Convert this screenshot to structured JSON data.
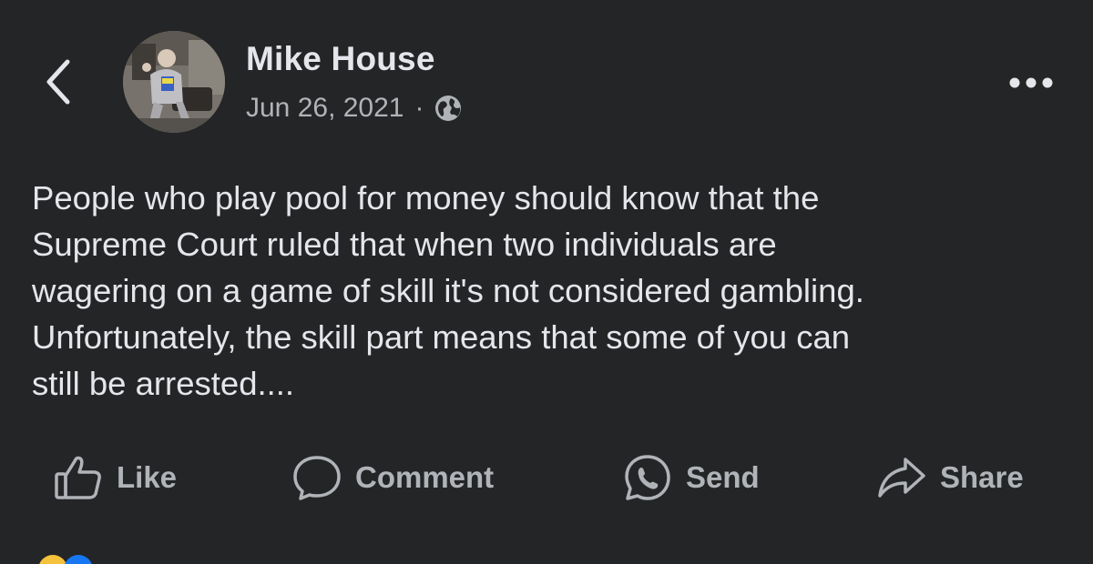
{
  "post": {
    "author": "Mike House",
    "date": "Jun 26, 2021",
    "separator": "·",
    "privacy_icon": "globe-icon",
    "lines": [
      "People who play pool for money should know that the",
      "Supreme Court ruled that when two individuals are",
      "wagering on a game of skill it's not considered gambling.",
      "Unfortunately, the skill part means that some of you can",
      "still be arrested...."
    ]
  },
  "actions": {
    "like": "Like",
    "comment": "Comment",
    "send": "Send",
    "share": "Share"
  },
  "colors": {
    "background": "#242526",
    "primary_text": "#e4e6eb",
    "secondary_text": "#b0b3b8"
  }
}
